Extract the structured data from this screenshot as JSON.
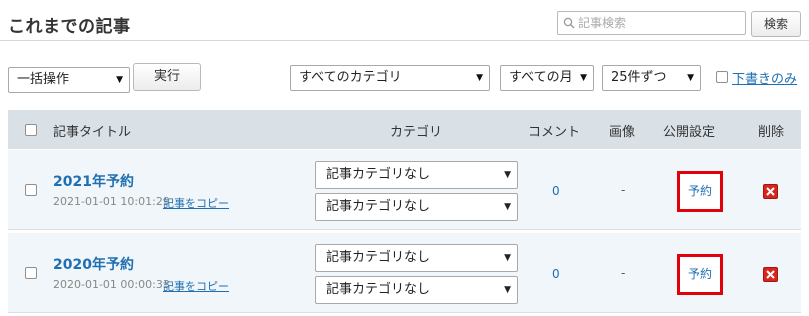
{
  "header": {
    "title": "これまでの記事",
    "search_placeholder": "記事検索",
    "search_button": "検索"
  },
  "toolbar": {
    "bulk_action": "一括操作",
    "execute_button": "実行",
    "category_filter": "すべてのカテゴリ",
    "month_filter": "すべての月",
    "per_page": "25件ずつ",
    "drafts_only": "下書きのみ"
  },
  "table": {
    "columns": {
      "title": "記事タイトル",
      "category": "カテゴリ",
      "comments": "コメント",
      "image": "画像",
      "visibility": "公開設定",
      "delete": "削除"
    },
    "rows": [
      {
        "title": "2021年予約",
        "datetime": "2021-01-01 10:01:29",
        "copy_link": "記事をコピー",
        "category_1": "記事カテゴリなし",
        "category_2": "記事カテゴリなし",
        "comments": "0",
        "image": "-",
        "status": "予約"
      },
      {
        "title": "2020年予約",
        "datetime": "2020-01-01 00:00:33",
        "copy_link": "記事をコピー",
        "category_1": "記事カテゴリなし",
        "category_2": "記事カテゴリなし",
        "comments": "0",
        "image": "-",
        "status": "予約"
      }
    ]
  },
  "colors": {
    "link": "#1f6fb2",
    "header_row_bg": "#d9e1e7",
    "row_bg": "#f0f6f9",
    "highlight_border": "#e2000b",
    "delete_red": "#d9261c"
  },
  "icons": {
    "search": "search-icon",
    "dropdown": "chevron-down-icon",
    "delete": "close-icon"
  }
}
